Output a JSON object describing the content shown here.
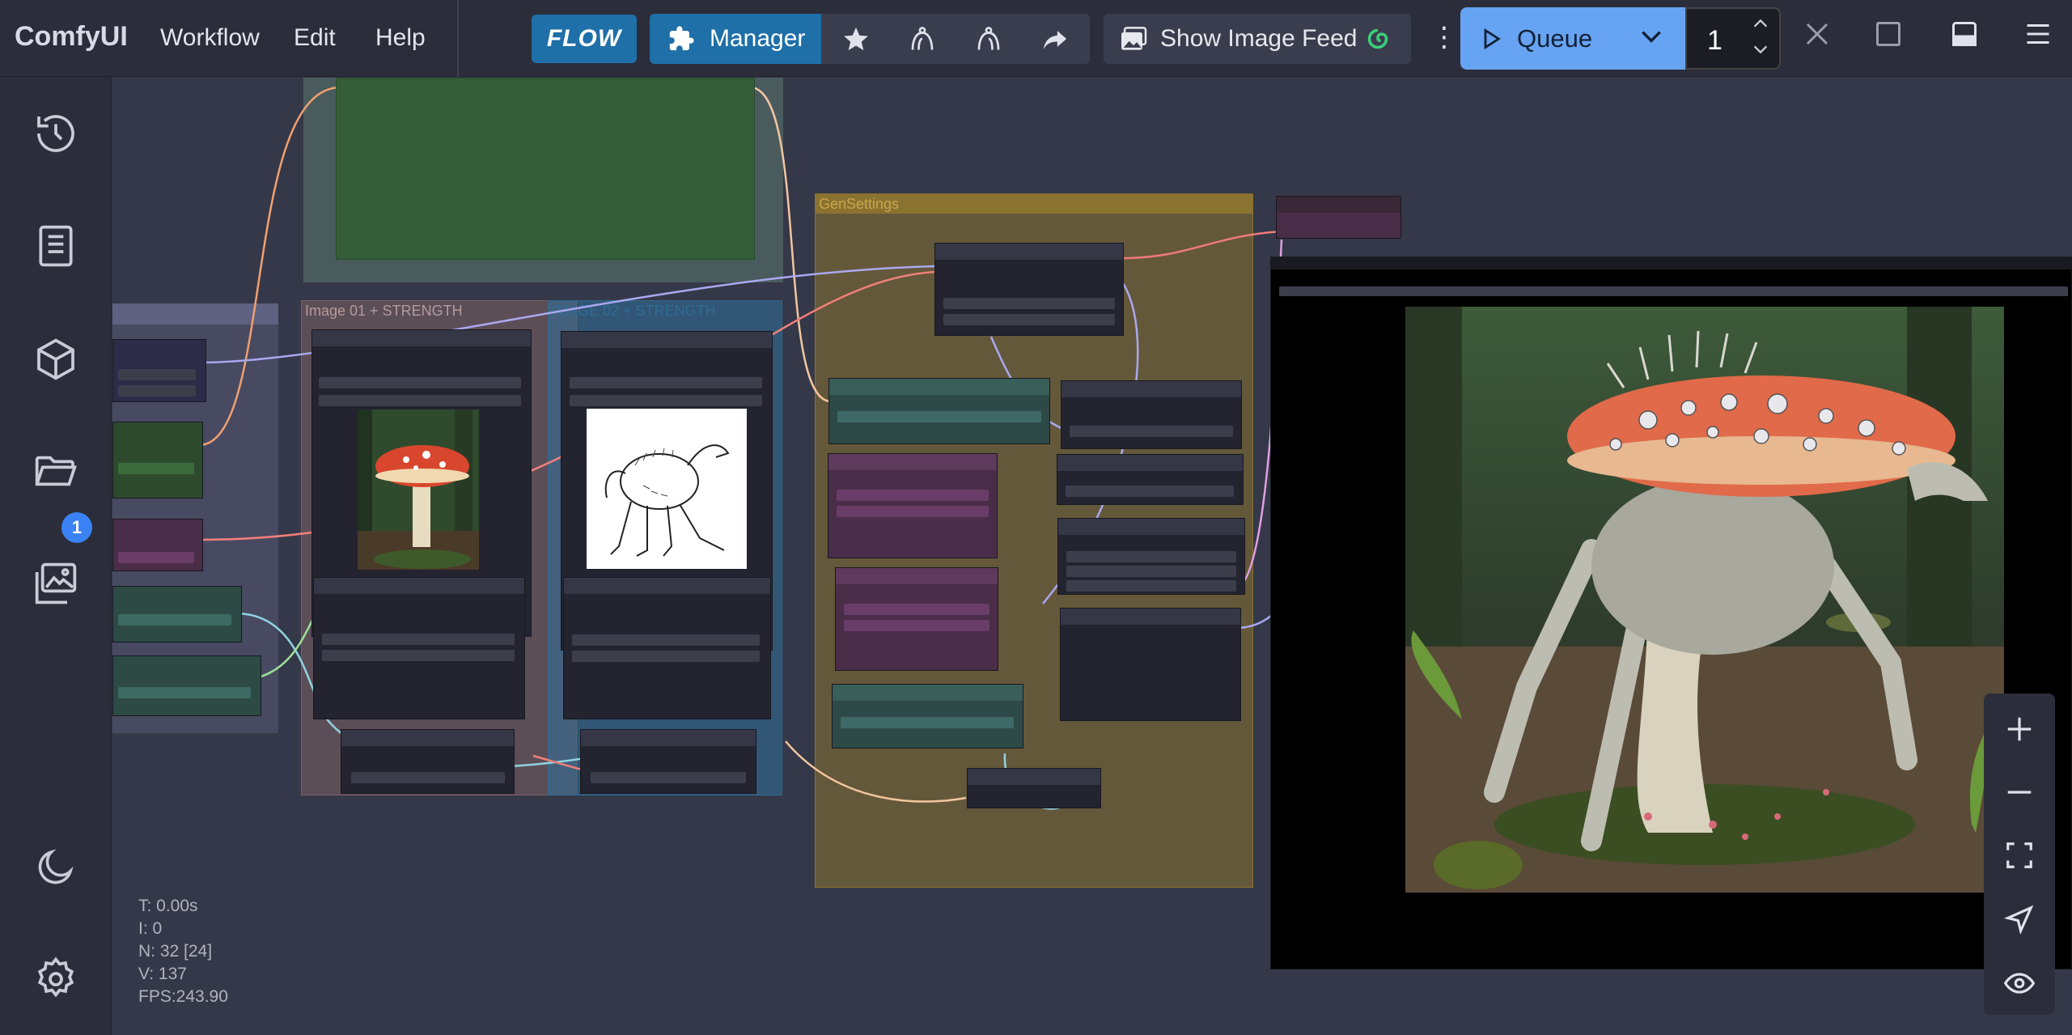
{
  "app": {
    "brand": "ComfyUI"
  },
  "menu": {
    "workflow": "Workflow",
    "edit": "Edit",
    "help": "Help"
  },
  "toolbar": {
    "flow_label": "FLOW",
    "manager_label": "Manager",
    "show_image_feed_label": "Show Image Feed",
    "queue_label": "Queue",
    "queue_count": "1"
  },
  "sidebar": {
    "queue_badge": "1"
  },
  "groups": {
    "image01": "Image 01 + STRENGTH",
    "image02": "IMAGE 02 + STRENGTH",
    "gen_settings": "GenSettings"
  },
  "stats": {
    "t": "T: 0.00s",
    "i": "I: 0",
    "n": "N: 32 [24]",
    "v": "V: 137",
    "fps": "FPS:243.90"
  },
  "colors": {
    "accent": "#1f6fa8",
    "queue": "#66a3f2",
    "group_gen": "#8a7230",
    "group_img1": "#8b6a6a",
    "group_img2": "#2f6f9a"
  }
}
